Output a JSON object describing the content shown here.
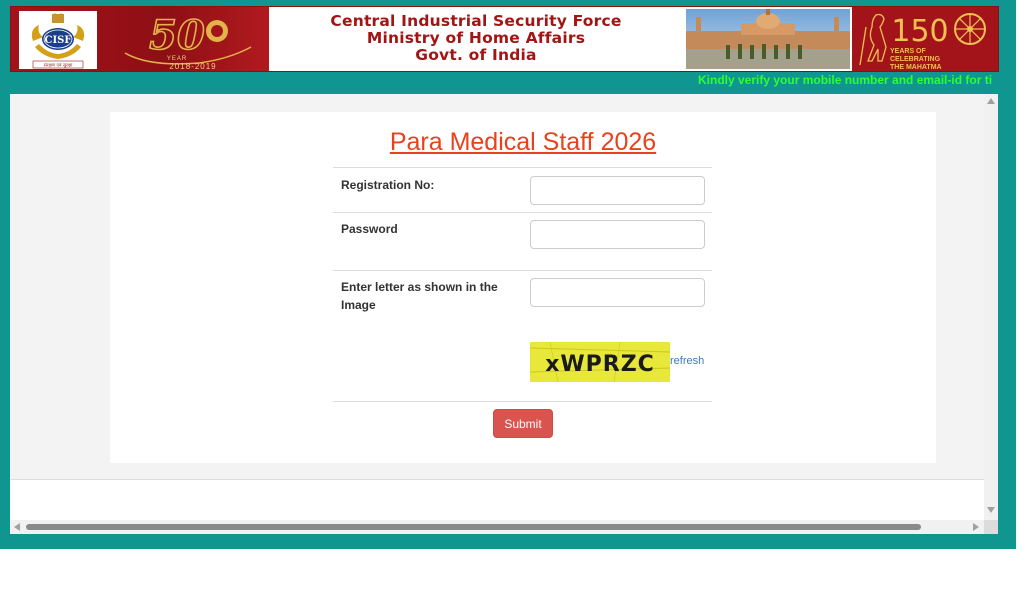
{
  "banner": {
    "org_name": "Central Industrial Security Force",
    "ministry": "Ministry of Home Affairs",
    "govt": "Govt. of India",
    "logo_text": "CISF",
    "logo_motto": "संरक्षण एवं सुरक्षा",
    "anniversary_number": "50",
    "anniversary_word": "YEAR",
    "anniversary_years": "2018-2019",
    "gandhi_number": "150",
    "gandhi_line1": "YEARS OF",
    "gandhi_line2": "CELEBRATING",
    "gandhi_line3": "THE MAHATMA"
  },
  "marquee": {
    "text": "Kindly verify your mobile number and email-id for ti"
  },
  "form": {
    "title": "Para Medical Staff 2026",
    "registration_label": "Registration No:",
    "registration_value": "",
    "password_label": "Password",
    "password_value": "",
    "captcha_label": "Enter letter as shown in the Image",
    "captcha_value": "",
    "captcha_text": "xWPRZC",
    "refresh_label": "refresh",
    "submit_label": "Submit"
  },
  "colors": {
    "frame": "#0f9690",
    "banner_red": "#a3141a",
    "title": "#e8421d",
    "submit": "#d9534f",
    "marquee": "#2cff2c",
    "link": "#3a7bbf"
  }
}
